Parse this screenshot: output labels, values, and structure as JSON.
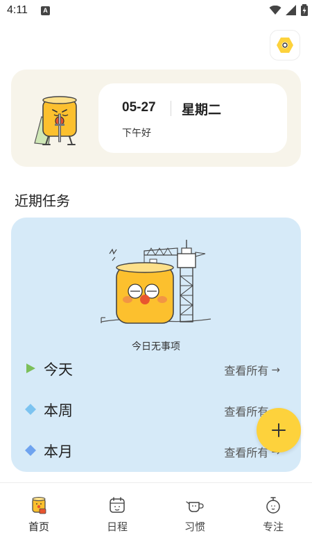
{
  "status_bar": {
    "time": "4:11",
    "a_badge": "A"
  },
  "greeting": {
    "date": "05-27",
    "weekday": "星期二",
    "greeting": "下午好"
  },
  "recent_tasks": {
    "title": "近期任务",
    "empty_text": "今日无事项",
    "rows": [
      {
        "label": "今天",
        "link": "查看所有",
        "marker_color": "#7cbf5a",
        "marker_shape": "triangle"
      },
      {
        "label": "本周",
        "link": "查看所有",
        "marker_color": "#7cc3f0",
        "marker_shape": "diamond"
      },
      {
        "label": "本月",
        "link": "查看所有",
        "marker_color": "#6fa3ef",
        "marker_shape": "diamond"
      }
    ]
  },
  "fab": {
    "icon": "plus-icon"
  },
  "nav": [
    {
      "label": "首页",
      "icon": "home-mascot-icon",
      "active": true
    },
    {
      "label": "日程",
      "icon": "calendar-icon",
      "active": false
    },
    {
      "label": "习惯",
      "icon": "habit-teapot-icon",
      "active": false
    },
    {
      "label": "专注",
      "icon": "stopwatch-icon",
      "active": false
    }
  ],
  "colors": {
    "accent": "#fdd23c",
    "greeting_card_bg": "#f7f4ea",
    "tasks_card_bg": "#d6eaf8"
  }
}
